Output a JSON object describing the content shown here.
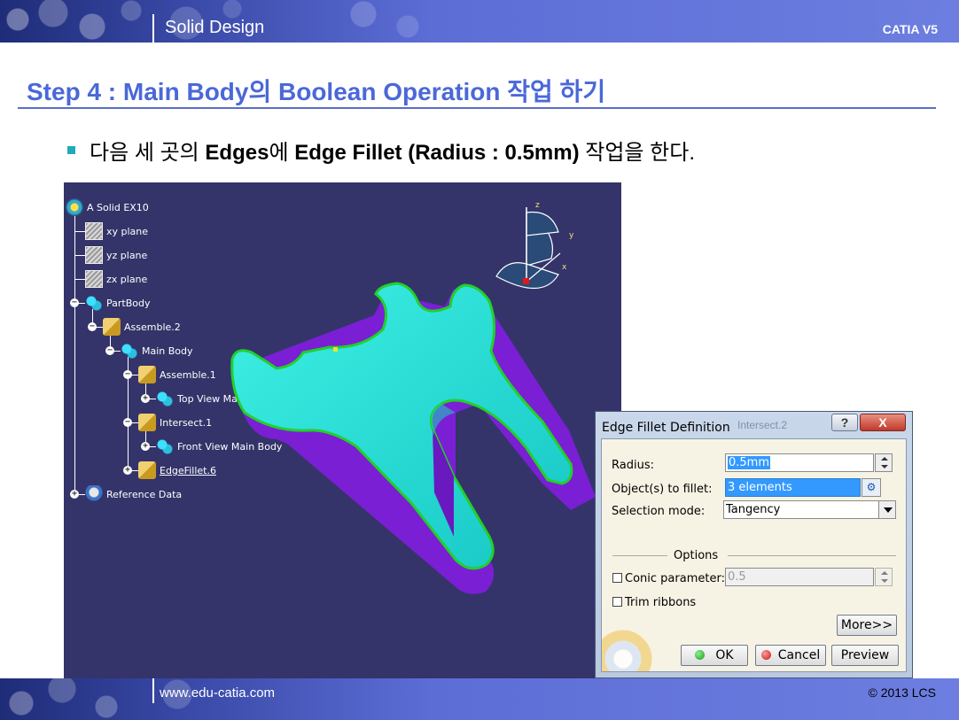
{
  "header": {
    "title": "Solid Design",
    "brand": "CATIA V5"
  },
  "slide": {
    "title": "Step 4 : Main Body의 Boolean Operation 작업 하기",
    "bullet": {
      "p1": "다음 세 곳의 ",
      "b1": "Edges",
      "p2": "에 ",
      "b2": "Edge Fillet (Radius : 0.5mm)",
      "p3": " 작업을 한다."
    }
  },
  "tree": {
    "root": "A Solid EX10",
    "xy": "xy plane",
    "yz": "yz plane",
    "zx": "zx plane",
    "partbody": "PartBody",
    "assemble2": "Assemble.2",
    "mainbody": "Main Body",
    "assemble1": "Assemble.1",
    "topview": "Top View Main Body",
    "intersect": "Intersect.1",
    "frontview": "Front View Main Body",
    "edgefillet": "EdgeFillet.6",
    "refdata": "Reference Data"
  },
  "compass": {
    "z": "z",
    "y": "y",
    "x": "x"
  },
  "dialog": {
    "title": "Edge Fillet Definition",
    "ghost_title": "Intersect.2",
    "help": "?",
    "close": "X",
    "radius_label": "Radius:",
    "radius_value": "0.5mm",
    "objects_label": "Object(s) to fillet:",
    "objects_value": "3 elements",
    "mode_label": "Selection mode:",
    "mode_value": "Tangency",
    "options": "Options",
    "conic_label": "Conic parameter:",
    "conic_value": "0.5",
    "trim_label": "Trim ribbons",
    "more": "More>>",
    "ok": "OK",
    "cancel": "Cancel",
    "preview": "Preview"
  },
  "footer": {
    "url": "www.edu-catia.com",
    "copyright": "© 2013 LCS"
  },
  "colors": {
    "part_top": "#20e4d8",
    "part_side": "#7a1fd4",
    "edge": "#22d02a",
    "viewport_bg": "#34346a",
    "title_blue": "#4a68d8"
  }
}
